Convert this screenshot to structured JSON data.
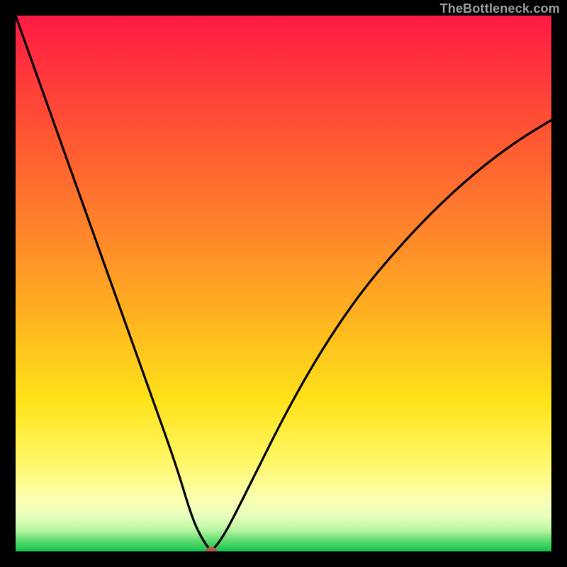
{
  "watermark": "TheBottleneck.com",
  "chart_data": {
    "type": "line",
    "title": "",
    "xlabel": "",
    "ylabel": "",
    "xlim": [
      0,
      100
    ],
    "ylim": [
      0,
      100
    ],
    "grid": false,
    "legend": false,
    "background": {
      "type": "vertical-gradient",
      "stops": [
        {
          "pos": 0,
          "color": "#ff1a44"
        },
        {
          "pos": 0.22,
          "color": "#ff5533"
        },
        {
          "pos": 0.42,
          "color": "#ff8a2a"
        },
        {
          "pos": 0.58,
          "color": "#ffb81f"
        },
        {
          "pos": 0.72,
          "color": "#ffe31a"
        },
        {
          "pos": 0.83,
          "color": "#fff765"
        },
        {
          "pos": 0.9,
          "color": "#fbffb0"
        },
        {
          "pos": 0.935,
          "color": "#e8ffbf"
        },
        {
          "pos": 0.96,
          "color": "#b8f5a0"
        },
        {
          "pos": 0.98,
          "color": "#5edc6e"
        },
        {
          "pos": 1.0,
          "color": "#13c24b"
        }
      ]
    },
    "series": [
      {
        "name": "bottleneck-curve",
        "color": "#000000",
        "x": [
          0,
          5,
          10,
          15,
          20,
          25,
          30,
          33,
          35,
          36.5,
          38,
          40,
          45,
          50,
          55,
          60,
          65,
          70,
          75,
          80,
          85,
          90,
          95,
          100
        ],
        "y": [
          100,
          86,
          72,
          58,
          44,
          30,
          16,
          6,
          2,
          0,
          1.7,
          5,
          15,
          25,
          34,
          42,
          49,
          55,
          60.5,
          65.5,
          70,
          74,
          77.5,
          80.5
        ]
      }
    ],
    "markers": [
      {
        "name": "vertex-marker",
        "x": 36.5,
        "y": 0,
        "shape": "rounded-rect",
        "color": "#b35a4a"
      }
    ]
  }
}
